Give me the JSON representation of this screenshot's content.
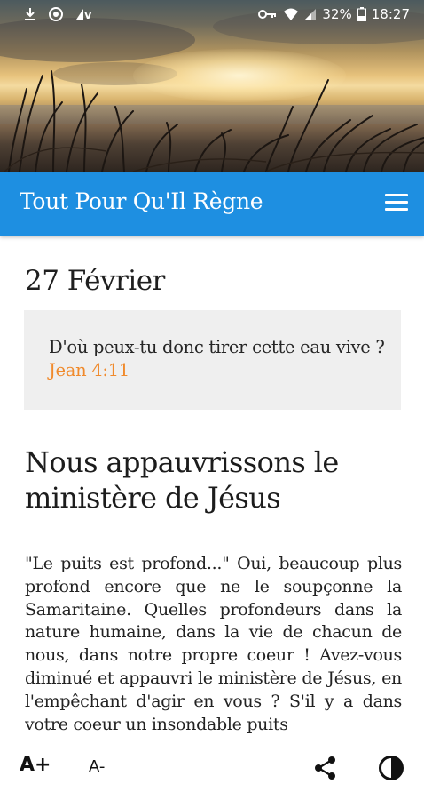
{
  "status_bar": {
    "battery": "32%",
    "time": "18:27",
    "icons": [
      "download-icon",
      "sync-icon",
      "vpn-icon",
      "key-icon",
      "wifi-icon",
      "signal-icon",
      "battery-icon"
    ]
  },
  "app_bar": {
    "title": "Tout Pour Qu'Il Règne",
    "menu_icon": "hamburger-menu-icon",
    "color": "#1e8fe1"
  },
  "devotional": {
    "date": "27 Février",
    "verse_text": "D'où peux-tu donc tirer cette eau vive ?",
    "verse_ref": "Jean 4:11",
    "verse_ref_color": "#f08a2c",
    "title": "Nous appauvrissons le ministère de Jésus",
    "body": "\"Le puits est profond...\" Oui, beaucoup plus profond encore que ne le soupçonne la Samaritaine. Quelles profondeurs dans la nature humaine, dans la vie de chacun de nous, dans notre propre coeur ! Avez-vous diminué et appauvri le ministère de Jésus, en l'empêchant d'agir en vous ? S'il y a dans votre coeur un insondable puits"
  },
  "toolbar": {
    "increase_font_label": "A+",
    "decrease_font_label": "A-",
    "share_icon": "share-icon",
    "contrast_icon": "contrast-icon"
  }
}
